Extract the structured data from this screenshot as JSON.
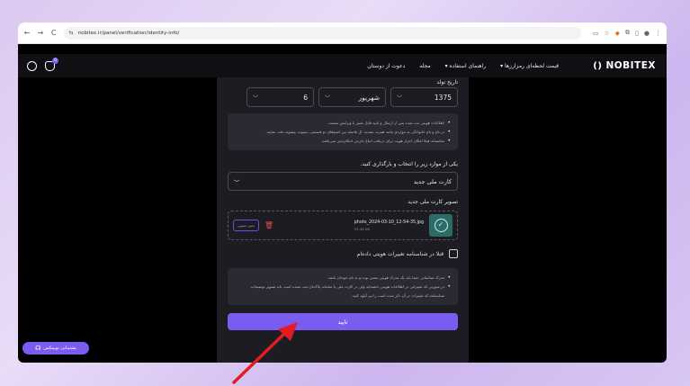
{
  "browser": {
    "url": "nobitex.ir/panel/verification/identity-info/",
    "back_icon": "←",
    "forward_icon": "→",
    "reload_icon": "C",
    "tune_icon": "⇆"
  },
  "header": {
    "logo_text": "NOBITEX",
    "logo_mark": "()",
    "badge_count": "0",
    "nav": [
      "قیمت لحظه‌ای رمزارزها ▾",
      "راهنمای استفاده ▾",
      "مجله",
      "دعوت از دوستان"
    ]
  },
  "form": {
    "birth_label": "تاریخ تولد",
    "year": "1375",
    "month": "شهریور",
    "day": "6",
    "notes": [
      "اطلاعات هویتی ثبت شده پس از ارسال و تایید قابل تغییر یا ویرایش نیستند.",
      "در نام و نام خانوادگی به مواردی مانند همزه، تشدید، ال فاصله بین اسم‌های دو قسمتی، پسوند، پیشوند دقت نمایید.",
      "متاسفانه فعلا امکان احراز هویت برای دریافت اتباع خارجی امکان‌پذیر نمی‌باشد."
    ],
    "choose_label": "یکی از موارد زیر را انتخاب و بارگذاری کنید.",
    "doc_type": "کارت ملی جدید",
    "image_label": "تصویر کارت ملی جدید",
    "file_name": "photo_2024-03-10_12-54-35.jpg",
    "file_size": "93.48 KB",
    "change_label": "تغییر تصویر",
    "checkbox_label": "قبلا در شناسنامه تغییرات هویتی داده‌ام",
    "notes2": [
      "مدرک شناسایی حتما باید یک مدرک هویتی معتبر بوده و به نام خودتان باشد.",
      "در صورتی که تغییراتی در اطلاعات هویتی داشته‌اید ولی در کارت ملی یا سامانه پلاک‌تان ثبت نشده است باید تصویر توضیحات شناسنامه که تغییرات در آن ذکر شده است را نیز آپلود کنید."
    ],
    "submit_label": "تایید"
  },
  "support": {
    "label": "پشتیبانی نوبیتکس"
  },
  "colors": {
    "accent": "#7b5cf0",
    "arrow": "#e31b23"
  }
}
